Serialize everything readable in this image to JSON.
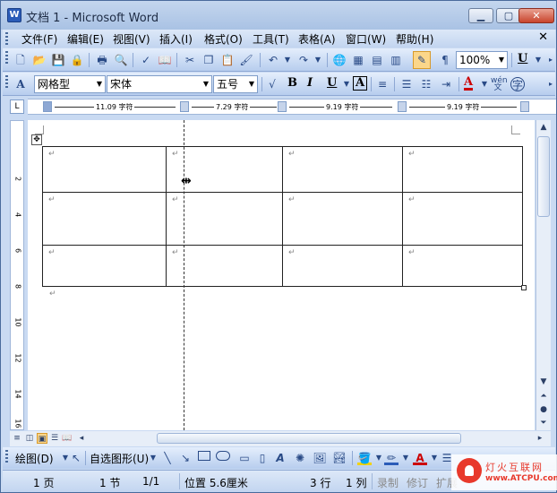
{
  "window": {
    "title": "文档 1 - Microsoft Word"
  },
  "menu": {
    "items": [
      "文件(F)",
      "编辑(E)",
      "视图(V)",
      "插入(I)",
      "格式(O)",
      "工具(T)",
      "表格(A)",
      "窗口(W)",
      "帮助(H)"
    ]
  },
  "standard_toolbar": {
    "zoom": "100%"
  },
  "format_toolbar": {
    "style": "网格型",
    "font": "宋体",
    "size": "五号",
    "bold": "B",
    "italic": "I",
    "underline": "U",
    "char_border": "A",
    "font_color": "A",
    "phonetic": "wén\n文",
    "enclose": "字"
  },
  "ruler": {
    "col_widths": [
      "11.09 字符",
      "7.29 字符",
      "9.19 字符",
      "9.19 字符"
    ],
    "tab_marker": "L"
  },
  "vruler": {
    "numbers": [
      "2",
      "4",
      "6",
      "8",
      "10",
      "12",
      "14",
      "16"
    ]
  },
  "table": {
    "rows": 3,
    "cols": 4,
    "para_mark": "↵"
  },
  "drawing_toolbar": {
    "draw": "绘图(D)",
    "autoshapes": "自选图形(U)"
  },
  "status": {
    "page": "1 页",
    "section": "1 节",
    "pages": "1/1",
    "position": "位置 5.6厘米",
    "line": "3 行",
    "col": "1 列",
    "rec": "录制",
    "trk": "修订",
    "ext": "扩展"
  },
  "watermark": {
    "cn": "灯火互联网",
    "en": "www.ATCPU.com"
  }
}
